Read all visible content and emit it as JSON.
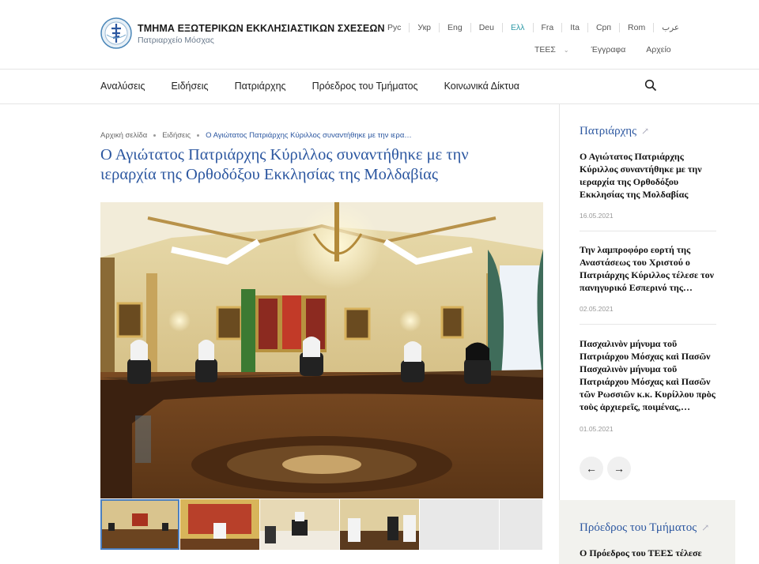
{
  "header": {
    "org_title": "ΤΜΗΜΑ ΕΞΩΤΕΡΙΚΩΝ ΕΚΚΛΗΣΙΑΣΤΙΚΩΝ ΣΧΕΣΕΩΝ",
    "org_subtitle": "Πατριαρχείο Μόσχας",
    "languages": [
      "Рус",
      "Укр",
      "Eng",
      "Deu",
      "Ελλ",
      "Fra",
      "Ita",
      "Срп",
      "Rom",
      "عرب"
    ],
    "active_language": "Ελλ",
    "subnav": {
      "dropdown_label": "ΤΕΕΣ",
      "documents_label": "Έγγραφα",
      "archive_label": "Αρχείο"
    }
  },
  "nav": {
    "items": [
      "Αναλύσεις",
      "Ειδήσεις",
      "Πατριάρχης",
      "Πρόεδρος του Τμήματος",
      "Κοινωνικά Δίκτυα"
    ],
    "search_icon": "search-icon"
  },
  "breadcrumb": {
    "home": "Αρχική σελίδα",
    "section": "Ειδήσεις",
    "current": "Ο Αγιώτατος Πατριάρχης Κύριλλος συναντήθηκε με την ιερα…"
  },
  "article": {
    "title": "Ο Αγιώτατος Πατριάρχης Κύριλλος συναντήθηκε με την ιεραρχία της Ορθοδόξου Εκκλησίας της Μολδαβίας"
  },
  "sidebar": {
    "patriarch_heading": "Πατριάρχης",
    "news": [
      {
        "title": "Ο Αγιώτατος Πατριάρχης Κύριλλος συναντήθηκε με την ιεραρχία της Ορθοδόξου Εκκλησίας της Μολδαβίας",
        "date": "16.05.2021"
      },
      {
        "title": "Την λαμπροφόρο εορτή της Αναστάσεως του Χριστού ο Πατριάρχης Κύριλλος τέλεσε τον πανηγυρικό Εσπερινό της…",
        "date": "02.05.2021"
      },
      {
        "title": "Πασχαλινὸν μήνυμα τοῦ Πατριάρχου Μόσχας καὶ Πασῶν Πασχαλινὸν μήνυμα τοῦ Πατριάρχου Μόσχας καὶ Πασῶν τῶν Ρωσσιῶν κ.κ. Κυρίλλου πρὸς τοὺς ἀρχιερεῖς, ποιμένας,…",
        "date": "01.05.2021"
      }
    ],
    "chair_heading": "Πρόεδρος του Τμήματος",
    "chair_news_partial": "Ο Πρόεδρος του ΤΕΕΣ τέλεσε"
  },
  "colors": {
    "accent_blue": "#2c57a0",
    "active_lang": "#2f9aa7"
  }
}
